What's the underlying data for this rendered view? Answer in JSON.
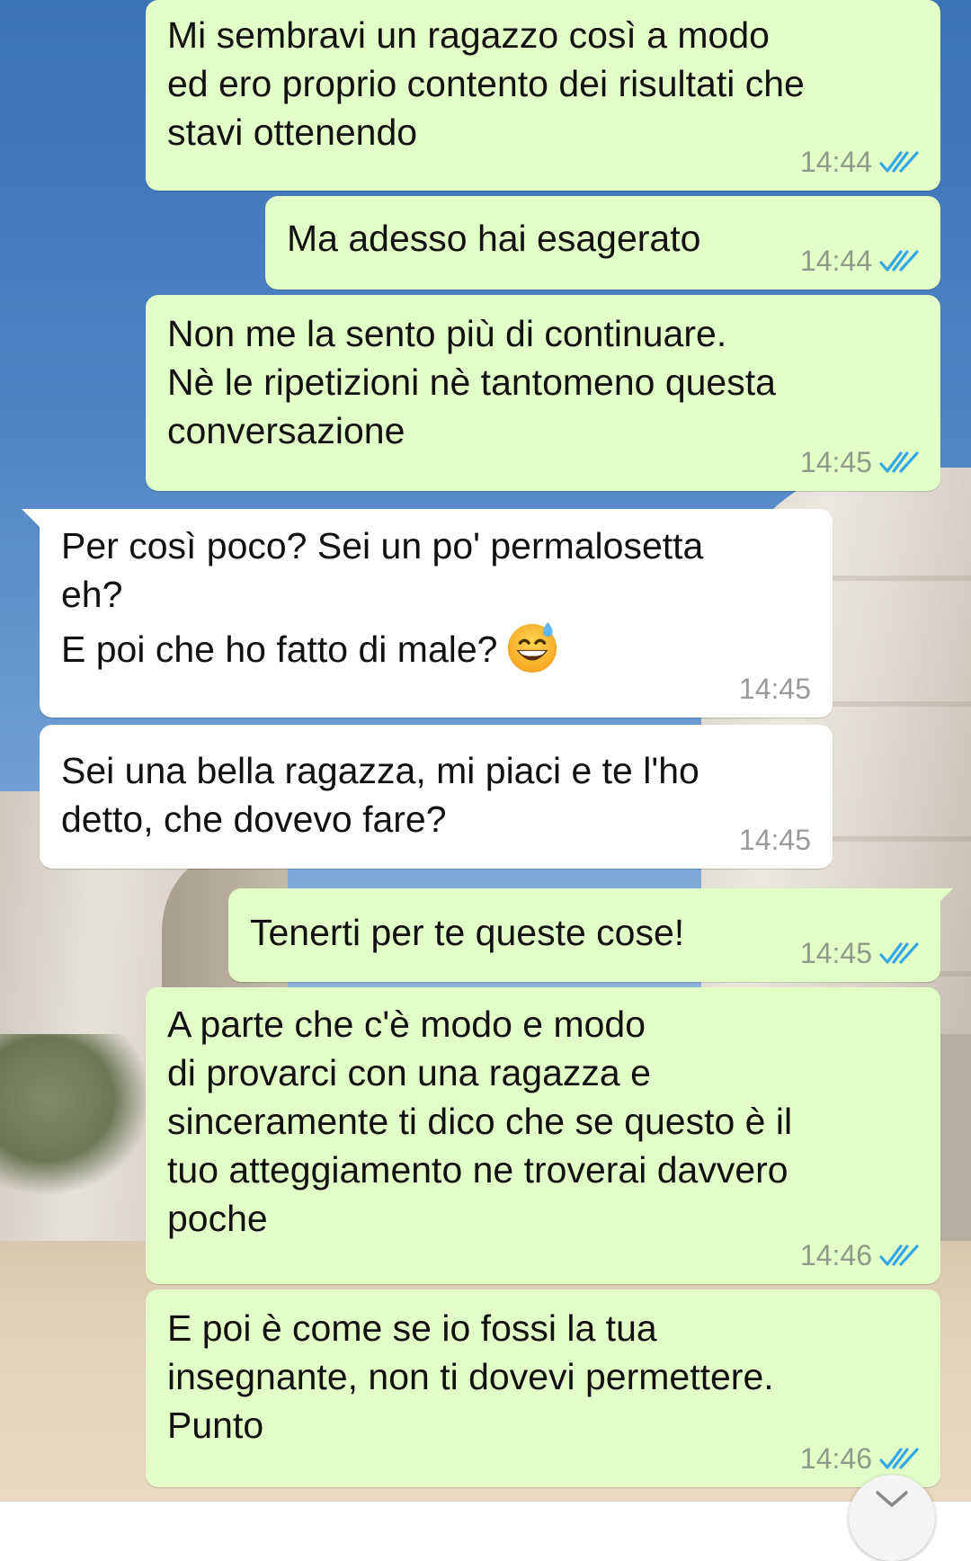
{
  "messages": [
    {
      "direction": "outgoing",
      "text": "Mi sembravi un ragazzo così a modo\ned ero proprio contento dei risultati che\nstavi ottenendo",
      "time": "14:44",
      "status": "read"
    },
    {
      "direction": "outgoing",
      "text": "Ma adesso hai esagerato",
      "time": "14:44",
      "status": "read"
    },
    {
      "direction": "outgoing",
      "text": "Non me la sento più di continuare.\nNè le ripetizioni nè tantomeno questa\nconversazione",
      "time": "14:45",
      "status": "read"
    },
    {
      "direction": "incoming",
      "text": "Per così poco? Sei un po' permalosetta\neh?\nE poi che ho fatto di male?",
      "emoji": "grinning-face-with-sweat",
      "time": "14:45"
    },
    {
      "direction": "incoming",
      "text": "Sei una bella ragazza, mi piaci e te l'ho\ndetto, che dovevo fare?",
      "time": "14:45"
    },
    {
      "direction": "outgoing",
      "text": "Tenerti per te queste cose!",
      "time": "14:45",
      "status": "read"
    },
    {
      "direction": "outgoing",
      "text": "A parte che c'è modo e modo\ndi provarci con una ragazza e\nsinceramente ti dico che se questo è il\ntuo atteggiamento ne troverai davvero\npoche",
      "time": "14:46",
      "status": "read"
    },
    {
      "direction": "outgoing",
      "text": "E poi è come se io fossi la tua\ninsegnante, non ti dovevi permettere.\nPunto",
      "time": "14:46",
      "status": "read"
    }
  ],
  "colors": {
    "outgoing_bubble": "#e2ffc7",
    "incoming_bubble": "#ffffff",
    "read_ticks": "#34a7e8",
    "timestamp": "#8e9a8a"
  },
  "icons": {
    "read_receipt": "double-check-icon",
    "scroll_down": "chevron-down-icon"
  }
}
